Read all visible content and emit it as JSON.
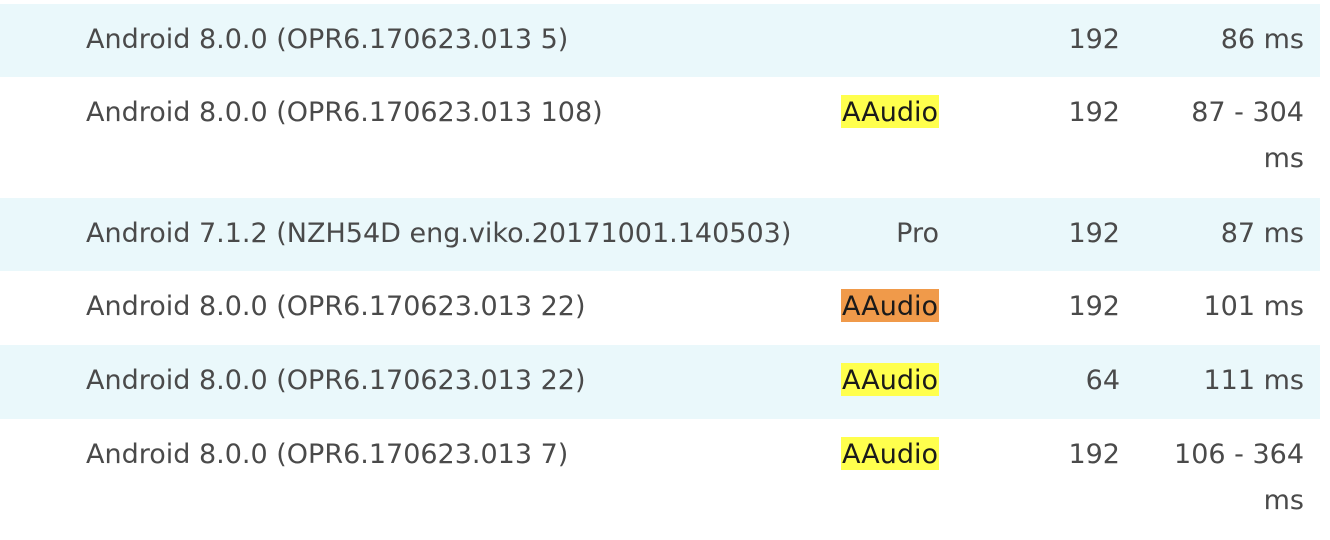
{
  "rows": [
    {
      "version": "Android 8.0.0 (OPR6.170623.013 5)",
      "tag": "",
      "tag_style": "",
      "buffer": "192",
      "latency": "86 ms"
    },
    {
      "version": "Android 8.0.0 (OPR6.170623.013 108)",
      "tag": "AAudio",
      "tag_style": "yellow",
      "buffer": "192",
      "latency": "87 - 304 ms"
    },
    {
      "version": "Android 7.1.2 (NZH54D eng.viko.20171001.140503)",
      "tag": "Pro",
      "tag_style": "",
      "buffer": "192",
      "latency": "87 ms"
    },
    {
      "version": "Android 8.0.0 (OPR6.170623.013 22)",
      "tag": "AAudio",
      "tag_style": "orange",
      "buffer": "192",
      "latency": "101 ms"
    },
    {
      "version": "Android 8.0.0 (OPR6.170623.013 22)",
      "tag": "AAudio",
      "tag_style": "yellow",
      "buffer": "64",
      "latency": "111 ms"
    },
    {
      "version": "Android 8.0.0 (OPR6.170623.013 7)",
      "tag": "AAudio",
      "tag_style": "yellow",
      "buffer": "192",
      "latency": "106 - 364 ms"
    }
  ],
  "colors": {
    "row_shade": "#eaf8fb",
    "badge_yellow": "#ffff4d",
    "badge_orange": "#f09a4a",
    "text": "#4a4a4a"
  }
}
